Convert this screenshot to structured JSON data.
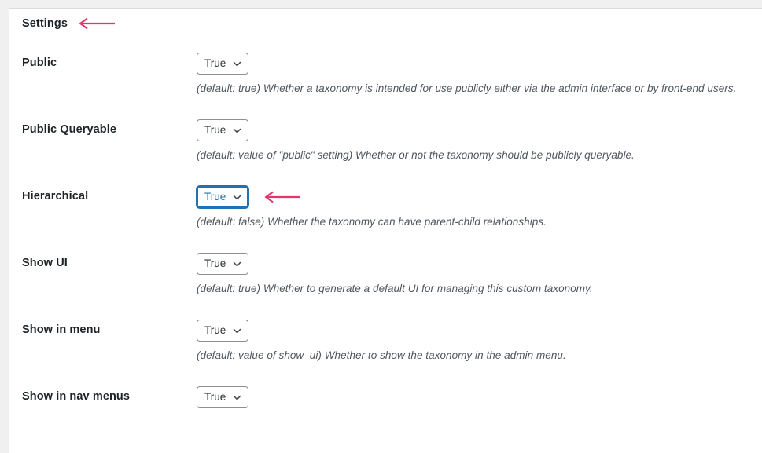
{
  "panel": {
    "title": "Settings",
    "title_annotation_arrow": "left-arrow-annotation",
    "accent_arrow_color": "#e8336d",
    "focus_color": "#2271b1",
    "label_color": "#1d2327",
    "description_color": "#50575e",
    "border_color": "#dcdcde",
    "page_background": "#f0f0f1"
  },
  "fields": [
    {
      "label": "Public",
      "value": "True",
      "description": "(default: true) Whether a taxonomy is intended for use publicly either via the admin interface or by front-end users.",
      "focused": false,
      "annotated": false
    },
    {
      "label": "Public Queryable",
      "value": "True",
      "description": "(default: value of \"public\" setting) Whether or not the taxonomy should be publicly queryable.",
      "focused": false,
      "annotated": false
    },
    {
      "label": "Hierarchical",
      "value": "True",
      "description": "(default: false) Whether the taxonomy can have parent-child relationships.",
      "focused": true,
      "annotated": true
    },
    {
      "label": "Show UI",
      "value": "True",
      "description": "(default: true) Whether to generate a default UI for managing this custom taxonomy.",
      "focused": false,
      "annotated": false
    },
    {
      "label": "Show in menu",
      "value": "True",
      "description": "(default: value of show_ui) Whether to show the taxonomy in the admin menu.",
      "focused": false,
      "annotated": false
    },
    {
      "label": "Show in nav menus",
      "value": "True",
      "description": "",
      "focused": false,
      "annotated": false
    }
  ]
}
